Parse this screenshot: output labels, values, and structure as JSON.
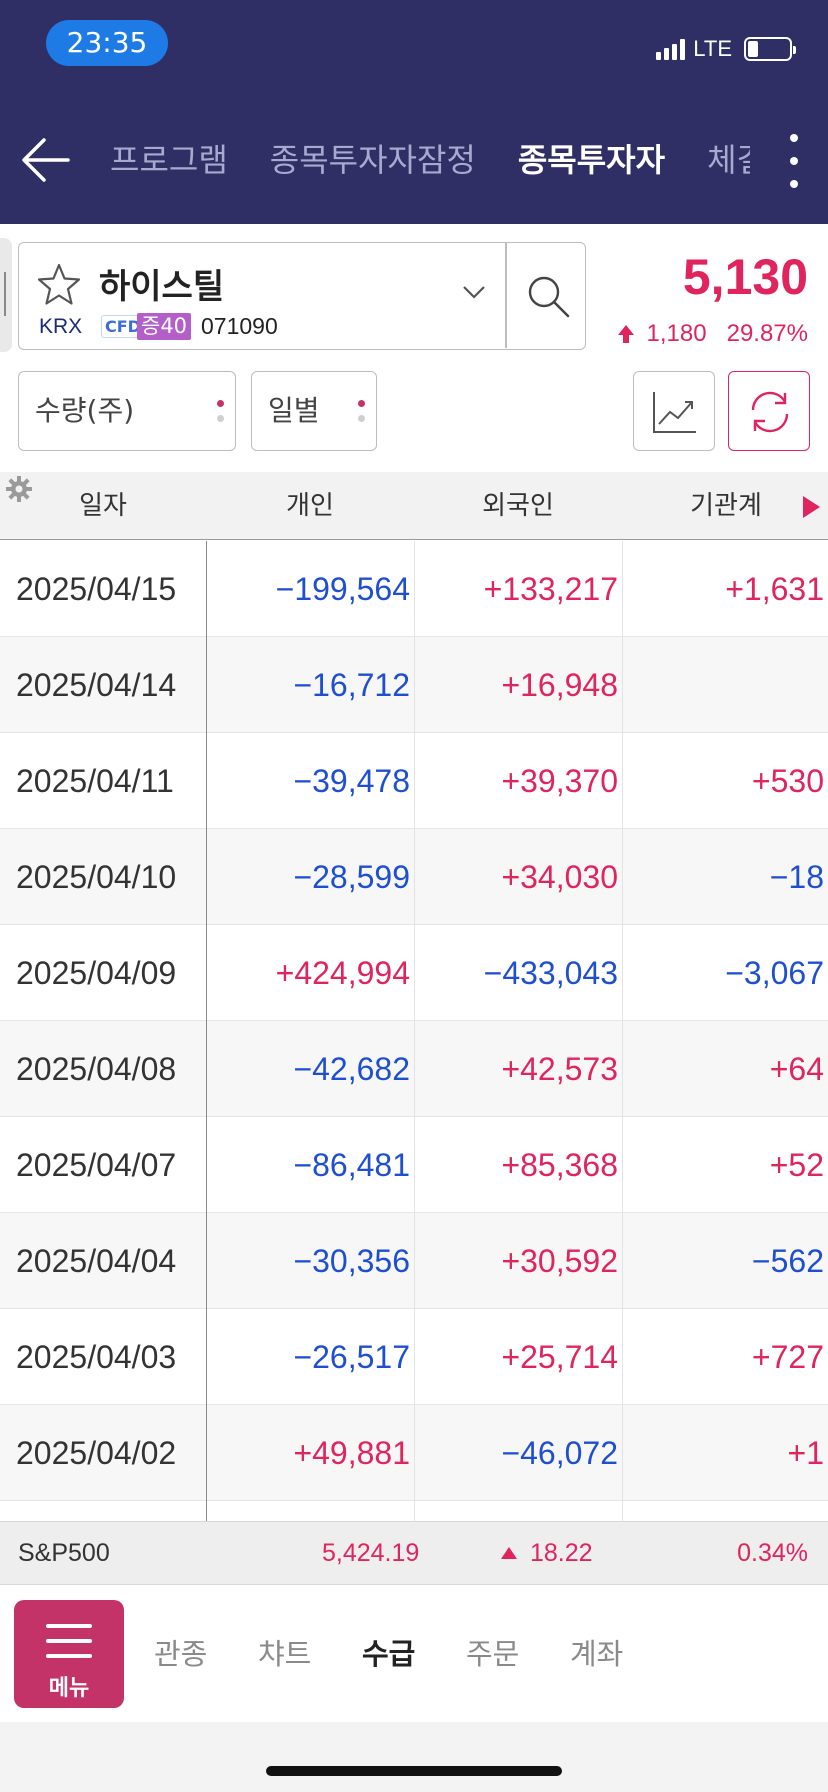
{
  "status_bar": {
    "time": "23:35",
    "network": "LTE"
  },
  "header": {
    "tabs": [
      {
        "label": "프로그램"
      },
      {
        "label": "종목투자자잠정"
      },
      {
        "label": "종목투자자"
      },
      {
        "label": "체결"
      }
    ],
    "active_tab": "종목투자자"
  },
  "stock": {
    "name": "하이스틸",
    "exchange": "KRX",
    "cfd_badge": "CFD",
    "margin_badge": "증40",
    "code": "071090",
    "price": "5,130",
    "change": "1,180",
    "change_pct": "29.87%"
  },
  "filters": {
    "unit": "수량(주)",
    "period": "일별"
  },
  "table": {
    "headers": [
      "일자",
      "개인",
      "외국인",
      "기관계"
    ],
    "rows": [
      {
        "date": "2025/04/15",
        "individual": "−199,564",
        "foreign": "+133,217",
        "institution": "+1,631"
      },
      {
        "date": "2025/04/14",
        "individual": "−16,712",
        "foreign": "+16,948",
        "institution": ""
      },
      {
        "date": "2025/04/11",
        "individual": "−39,478",
        "foreign": "+39,370",
        "institution": "+530"
      },
      {
        "date": "2025/04/10",
        "individual": "−28,599",
        "foreign": "+34,030",
        "institution": "−18"
      },
      {
        "date": "2025/04/09",
        "individual": "+424,994",
        "foreign": "−433,043",
        "institution": "−3,067"
      },
      {
        "date": "2025/04/08",
        "individual": "−42,682",
        "foreign": "+42,573",
        "institution": "+64"
      },
      {
        "date": "2025/04/07",
        "individual": "−86,481",
        "foreign": "+85,368",
        "institution": "+52"
      },
      {
        "date": "2025/04/04",
        "individual": "−30,356",
        "foreign": "+30,592",
        "institution": "−562"
      },
      {
        "date": "2025/04/03",
        "individual": "−26,517",
        "foreign": "+25,714",
        "institution": "+727"
      },
      {
        "date": "2025/04/02",
        "individual": "+49,881",
        "foreign": "−46,072",
        "institution": "+1"
      }
    ]
  },
  "ticker": {
    "name": "S&P500",
    "value": "5,424.19",
    "change": "18.22",
    "change_pct": "0.34%"
  },
  "bottom_nav": {
    "menu_label": "메뉴",
    "items": [
      "관종",
      "챠트",
      "수급",
      "주문",
      "계좌"
    ],
    "active": "수급"
  },
  "colors": {
    "header_bg": "#2f2f66",
    "up": "#e0245e",
    "down": "#1f4fd1",
    "menu_bg": "#c43367",
    "time_pill": "#1e7be6"
  }
}
